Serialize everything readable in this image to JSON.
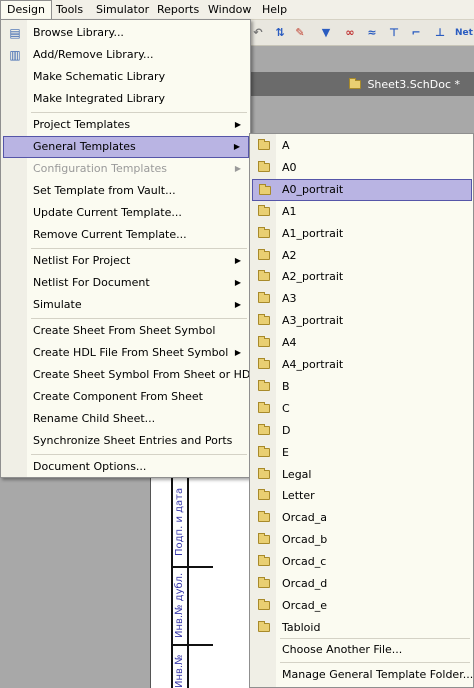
{
  "menubar": {
    "items": [
      "Design",
      "Tools",
      "Simulator",
      "Reports",
      "Window",
      "Help"
    ],
    "active": "Design"
  },
  "toolbar": {
    "net_label": "Net"
  },
  "document": {
    "tab_label": "Sheet3.SchDoc *",
    "sheet_labels": [
      "Подп. и дата",
      "Инв.№ дубл.",
      "Инв.№"
    ]
  },
  "design_menu": {
    "items": [
      {
        "label": "Browse Library...",
        "icon": "library-icon"
      },
      {
        "label": "Add/Remove Library...",
        "icon": "book-icon"
      },
      {
        "label": "Make Schematic Library"
      },
      {
        "label": "Make Integrated Library"
      },
      {
        "label": "Project Templates",
        "submenu": true
      },
      {
        "label": "General Templates",
        "submenu": true,
        "highlighted": true
      },
      {
        "label": "Configuration Templates",
        "submenu": true,
        "disabled": true
      },
      {
        "label": "Set Template from Vault..."
      },
      {
        "label": "Update Current Template..."
      },
      {
        "label": "Remove Current Template..."
      },
      {
        "label": "Netlist For Project",
        "submenu": true
      },
      {
        "label": "Netlist For Document",
        "submenu": true
      },
      {
        "label": "Simulate",
        "submenu": true
      },
      {
        "label": "Create Sheet From Sheet Symbol"
      },
      {
        "label": "Create HDL File From Sheet Symbol",
        "submenu": true
      },
      {
        "label": "Create Sheet Symbol From Sheet or HDL"
      },
      {
        "label": "Create Component From Sheet"
      },
      {
        "label": "Rename Child Sheet..."
      },
      {
        "label": "Synchronize Sheet Entries and Ports"
      },
      {
        "label": "Document Options..."
      }
    ]
  },
  "general_templates": {
    "items": [
      "A",
      "A0",
      "A0_portrait",
      "A1",
      "A1_portrait",
      "A2",
      "A2_portrait",
      "A3",
      "A3_portrait",
      "A4",
      "A4_portrait",
      "B",
      "C",
      "D",
      "E",
      "Legal",
      "Letter",
      "Orcad_a",
      "Orcad_b",
      "Orcad_c",
      "Orcad_d",
      "Orcad_e",
      "Tabloid"
    ],
    "highlighted": "A0_portrait",
    "choose_another": "Choose Another File...",
    "manage": "Manage General Template Folder..."
  },
  "colors": {
    "menu_bg": "#fbfbf1",
    "highlight_bg": "#b9b4e3",
    "highlight_border": "#5555a8",
    "disabled_text": "#9a9a9a"
  }
}
